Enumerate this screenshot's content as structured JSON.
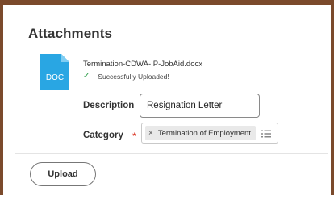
{
  "section": {
    "title": "Attachments"
  },
  "attachment": {
    "icon_name": "doc-file-icon",
    "icon_label": "DOC",
    "icon_color": "#29a6e3",
    "filename": "Termination-CDWA-IP-JobAid.docx",
    "status_text": "Successfully Uploaded!",
    "status_color": "#2e9e4a"
  },
  "form": {
    "description_label": "Description",
    "description_value": "Resignation Letter",
    "category_label": "Category",
    "required_marker": "*",
    "category_selected": "Termination of Employment",
    "category_remove_glyph": "×"
  },
  "actions": {
    "upload_label": "Upload"
  },
  "colors": {
    "frame_border": "#7b4a2c",
    "required": "#d9301f"
  }
}
